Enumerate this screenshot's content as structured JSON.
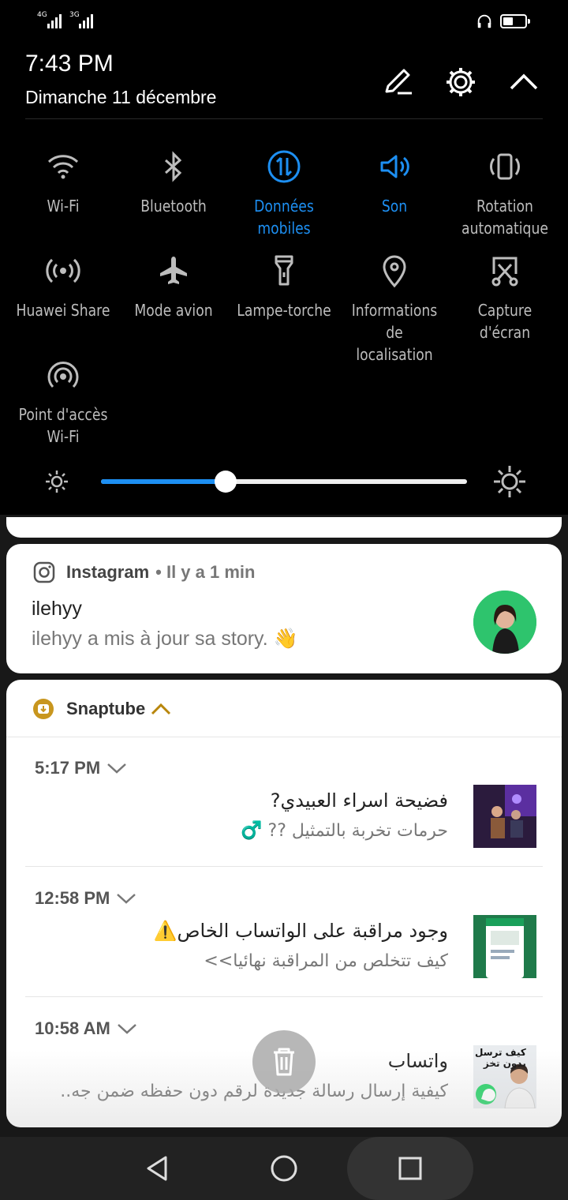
{
  "status_bar": {
    "sim1": "4G",
    "sim2": "3G",
    "icons": [
      "signal-icon",
      "signal-icon",
      "headset-icon",
      "battery-icon"
    ]
  },
  "header": {
    "time": "7:43 PM",
    "date": "Dimanche 11 décembre",
    "icons": [
      "edit-icon",
      "settings-gear-icon",
      "collapse-chevron-up-icon"
    ]
  },
  "quick_settings": {
    "tiles": [
      {
        "label": "Wi-Fi",
        "icon": "wifi-icon",
        "active": false
      },
      {
        "label": "Bluetooth",
        "icon": "bluetooth-icon",
        "active": false
      },
      {
        "label": "Données\nmobiles",
        "icon": "mobile-data-icon",
        "active": true
      },
      {
        "label": "Son",
        "icon": "sound-icon",
        "active": true
      },
      {
        "label": "Rotation\nautomatique",
        "icon": "rotation-icon",
        "active": false
      },
      {
        "label": "Huawei Share",
        "icon": "huawei-share-icon",
        "active": false
      },
      {
        "label": "Mode avion",
        "icon": "airplane-icon",
        "active": false
      },
      {
        "label": "Lampe-torche",
        "icon": "flashlight-icon",
        "active": false
      },
      {
        "label": "Informations\nde localisation",
        "icon": "location-icon",
        "active": false
      },
      {
        "label": "Capture\nd'écran",
        "icon": "screenshot-icon",
        "active": false
      },
      {
        "label": "Point d'accès\nWi-Fi",
        "icon": "hotspot-icon",
        "active": false
      }
    ],
    "brightness_level": 0.34,
    "accent_color": "#1d8ff2"
  },
  "notifications": {
    "instagram": {
      "app": "Instagram",
      "when": "• Il y a 1 min",
      "title": "ilehyy",
      "text": "ilehyy a mis à jour sa story. 👋"
    },
    "snaptube": {
      "app": "Snaptube",
      "items": [
        {
          "time": "5:17 PM",
          "title": "فضيحة اسراء العبيدي?",
          "body": "حرمات تخربة بالتمثيل ?? ♂️"
        },
        {
          "time": "12:58 PM",
          "title": "وجود مراقبة على الواتساب الخاص⚠️",
          "body": "كيف تتخلص من المراقبة نهائيا>>"
        },
        {
          "time": "10:58 AM",
          "title": "واتساب",
          "body": "كيفية إرسال رسالة جديدة لرقم دون حفظه ضمن جه..",
          "thumb_text": "كيف ترسل\nبدون تخز"
        }
      ]
    }
  },
  "nav_bar": {
    "icons": [
      "back-icon",
      "home-icon",
      "recents-icon"
    ]
  }
}
